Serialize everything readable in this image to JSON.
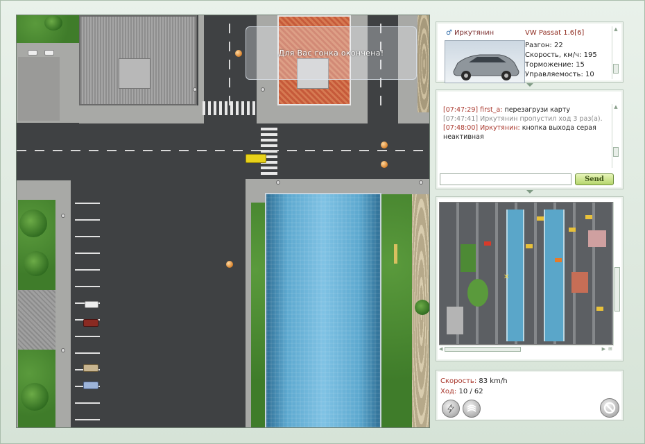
{
  "overlay": {
    "message": "Для Вас гонка окончена!"
  },
  "player": {
    "name": "Иркутянин",
    "car_model": "VW Passat 1.6[6]",
    "stats": [
      {
        "label": "Разгон:",
        "value": "22"
      },
      {
        "label": "Скорость, км/ч:",
        "value": "195"
      },
      {
        "label": "Торможение:",
        "value": "15"
      },
      {
        "label": "Управляемость:",
        "value": "10"
      }
    ]
  },
  "chat": {
    "messages": [
      {
        "time": "[07:47:29]",
        "author": "first_a:",
        "text": "перезагрузи карту",
        "type": "user"
      },
      {
        "time": "[07:47:41]",
        "text": "Иркутянин пропустил ход 3 раз(а).",
        "type": "system"
      },
      {
        "time": "[07:48:00]",
        "author": "Иркутянин:",
        "text": "кнопка выхода серая неактивная",
        "type": "user"
      }
    ],
    "input_value": "",
    "send_label": "Send"
  },
  "status": {
    "speed_label": "Скорость:",
    "speed_value": "83 km/h",
    "turn_label": "Ход:",
    "turn_value": "10 / 62"
  },
  "icons": {
    "gender": "male-icon",
    "nitro": "lightning-icon",
    "signal": "waves-icon",
    "exit": "no-entry-icon"
  },
  "colors": {
    "accent_red": "#a8352a",
    "send_green": "#b6d66c",
    "panel_border": "#b8c6ba"
  }
}
